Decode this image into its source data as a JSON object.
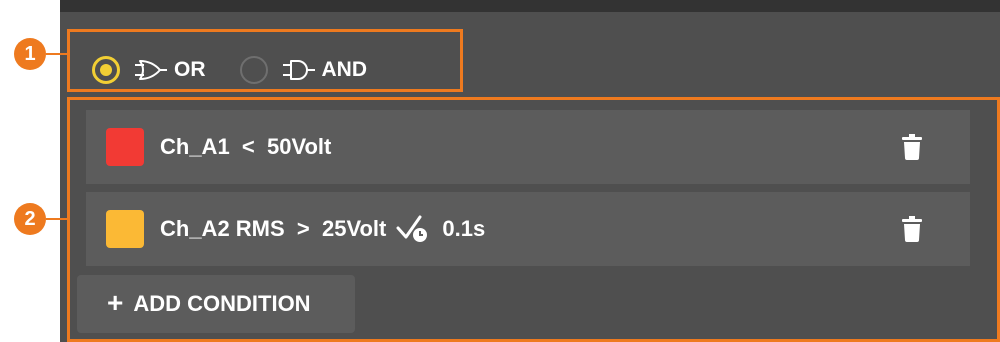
{
  "colors": {
    "accent_orange": "#ee7a1f",
    "radio_selected": "#f2cf34",
    "channel_a1": "#f23a34",
    "channel_a2": "#fbb935"
  },
  "callouts": {
    "first": "1",
    "second": "2"
  },
  "logic": {
    "selected": "OR",
    "options": [
      {
        "label": "OR",
        "icon": "or-gate-icon",
        "checked": true
      },
      {
        "label": "AND",
        "icon": "and-gate-icon",
        "checked": false
      }
    ]
  },
  "conditions": [
    {
      "channel": "Ch_A1",
      "text": "Ch_A1  <  50Volt",
      "color": "#f23a34"
    },
    {
      "channel": "Ch_A2",
      "text": "Ch_A2 RMS  >  25Volt",
      "delay_icon": "delay-timer-icon",
      "delay": "0.1s",
      "color": "#fbb935"
    }
  ],
  "add_button": {
    "icon": "plus-icon",
    "label": "ADD CONDITION"
  }
}
